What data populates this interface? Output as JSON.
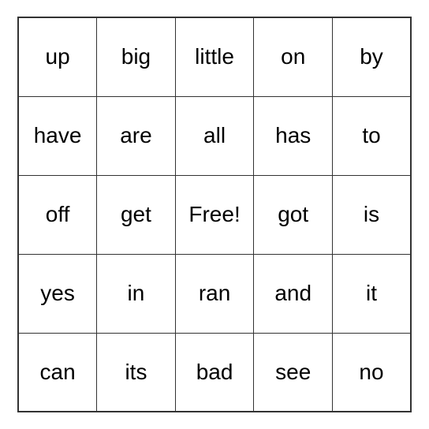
{
  "grid": [
    [
      "up",
      "big",
      "little",
      "on",
      "by"
    ],
    [
      "have",
      "are",
      "all",
      "has",
      "to"
    ],
    [
      "off",
      "get",
      "Free!",
      "got",
      "is"
    ],
    [
      "yes",
      "in",
      "ran",
      "and",
      "it"
    ],
    [
      "can",
      "its",
      "bad",
      "see",
      "no"
    ]
  ]
}
